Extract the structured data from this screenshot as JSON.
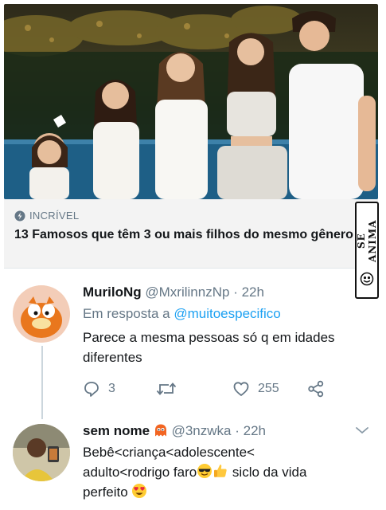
{
  "article": {
    "category": "INCRÍVEL",
    "headline": "13 Famosos que têm 3 ou mais filhos do mesmo gênero"
  },
  "watermark": {
    "text": "SE ANIMA"
  },
  "tweets": [
    {
      "display_name": "MuriloNg",
      "handle": "@MxrilinnzNp",
      "separator": "·",
      "time": "22h",
      "reply_prefix": "Em resposta a",
      "reply_to": "@muitoespecifico",
      "text": "Parece a mesma pessoas só q em idades diferentes",
      "reply_count": "3",
      "like_count": "255"
    },
    {
      "display_name": "sem nome",
      "handle": "@3nzwka",
      "separator": "·",
      "time": "22h",
      "text_line1": "Bebê<criança<adolescente<",
      "text_line2_a": "adulto<rodrigo faro",
      "text_line2_b": " siclo da vida",
      "text_line3": "perfeito"
    }
  ],
  "icons": {
    "category": "bolt-icon",
    "reply": "reply-icon",
    "retweet": "retweet-icon",
    "like": "heart-icon",
    "share": "share-icon",
    "more": "chevron-down-icon"
  },
  "colors": {
    "link": "#1da1f2",
    "muted": "#657786",
    "text": "#14171a"
  }
}
